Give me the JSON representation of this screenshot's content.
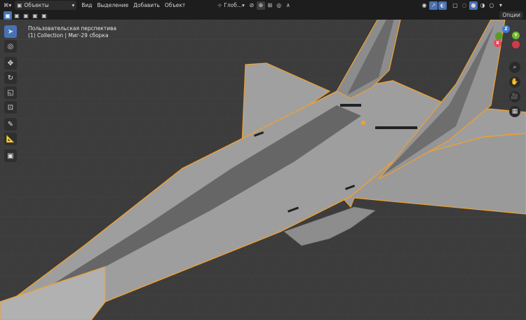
{
  "header": {
    "mode_label": "Объекты",
    "menu": [
      "Вид",
      "Выделение",
      "Добавить",
      "Объект"
    ],
    "transform_orientation": "Глоб...",
    "options_label": "Опции"
  },
  "viewport": {
    "view_name": "Пользовательская перспектива",
    "collection_line": "(1) Collection | Миг-29 сборка"
  },
  "toolbar": {
    "tools": [
      "select-box-tool",
      "cursor-tool",
      "move-tool",
      "rotate-tool",
      "scale-tool",
      "transform-tool",
      "annotate-tool",
      "measure-tool",
      "add-cube-tool"
    ]
  },
  "gizmo": {
    "x": "X",
    "y": "Y",
    "z": "Z"
  },
  "colors": {
    "accent": "#4772b3",
    "selection_outline": "#f0a030",
    "axis_x": "#e8475a",
    "axis_y": "#6eb82e",
    "axis_z": "#3f7cd6",
    "model": "#9b9b9b"
  }
}
